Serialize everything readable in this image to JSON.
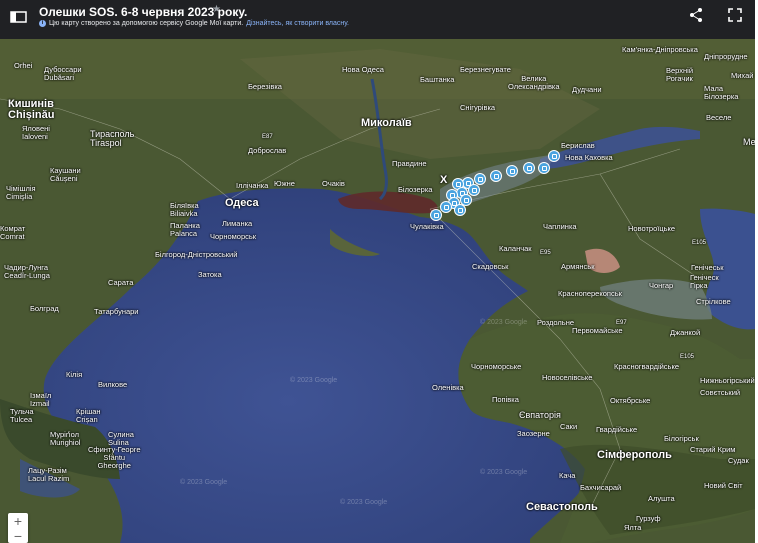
{
  "header": {
    "title": "Олешки SOS. 6-8 червня 2023 року.",
    "subtitle": "Цю карту створено за допомогою сервісу Google Мої карти.",
    "learn_link": "Дізнайтесь, як створити власну.",
    "icons": [
      "menu-icon",
      "star-icon",
      "info-icon",
      "share-icon",
      "fullscreen-icon"
    ]
  },
  "map": {
    "places": [
      {
        "name": "Orhei"
      },
      {
        "name": "Дубоссари\nDubăsari"
      },
      {
        "name": "Кишинів\nChișinău"
      },
      {
        "name": "Яловені\nIaloveni"
      },
      {
        "name": "Тирасполь\nTiraspol"
      },
      {
        "name": "Каушани\nCăușeni"
      },
      {
        "name": "Чімішлія\nCimişlia"
      },
      {
        "name": "Комрат\nComrat"
      },
      {
        "name": "Чадир-Лунга\nCeadîr-Lunga"
      },
      {
        "name": "Болград"
      },
      {
        "name": "Ізмаїл\nIzmail"
      },
      {
        "name": "Тульча\nTulcea"
      },
      {
        "name": "Кілія"
      },
      {
        "name": "Вилкове"
      },
      {
        "name": "Крішан\nCrișan"
      },
      {
        "name": "Муріґіол\nMurighiol"
      },
      {
        "name": "Сулина\nSulina"
      },
      {
        "name": "Сфинту-Георге\nSfântu\nGheorghe"
      },
      {
        "name": "Лацу-Разім\nLacul Razim"
      },
      {
        "name": "Сарата"
      },
      {
        "name": "Татарбунари"
      },
      {
        "name": "Біляївка\nBiliaivka"
      },
      {
        "name": "Паланка\nPalanca"
      },
      {
        "name": "Одеса"
      },
      {
        "name": "Лиманка"
      },
      {
        "name": "Чорноморськ"
      },
      {
        "name": "Білгород-Дністровський"
      },
      {
        "name": "Затока"
      },
      {
        "name": "Ізмаїл"
      },
      {
        "name": "Березівка"
      },
      {
        "name": "Нова Одеса"
      },
      {
        "name": "Баштанка"
      },
      {
        "name": "Березнегувате"
      },
      {
        "name": "Велика\nОлександрівка"
      },
      {
        "name": "Снігурівка"
      },
      {
        "name": "Миколаїв"
      },
      {
        "name": "Доброслав"
      },
      {
        "name": "Правдине"
      },
      {
        "name": "Іллічанка"
      },
      {
        "name": "Южне"
      },
      {
        "name": "Очаків"
      },
      {
        "name": "Білозерка"
      },
      {
        "name": "Х"
      },
      {
        "name": "Берислав"
      },
      {
        "name": "Нова Каховка"
      },
      {
        "name": "Дудчани"
      },
      {
        "name": "Кам'янка-Дніпровська"
      },
      {
        "name": "Дніпрорудне"
      },
      {
        "name": "Верхній\nРогачик"
      },
      {
        "name": "Михай"
      },
      {
        "name": "Мала\nБілозерка"
      },
      {
        "name": "Веселе"
      },
      {
        "name": "Ме"
      },
      {
        "name": "Чаплинка"
      },
      {
        "name": "Новотроїцьке"
      },
      {
        "name": "Чулаківка"
      },
      {
        "name": "Каланчак"
      },
      {
        "name": "Скадовськ"
      },
      {
        "name": "Армянськ"
      },
      {
        "name": "Чонгар"
      },
      {
        "name": "Генічеськ"
      },
      {
        "name": "Геніческ\nГірка"
      },
      {
        "name": "Стрілкове"
      },
      {
        "name": "Красноперекопськ"
      },
      {
        "name": "Роздольне"
      },
      {
        "name": "Первомайське"
      },
      {
        "name": "Джанкой"
      },
      {
        "name": "Чорноморське"
      },
      {
        "name": "Оленівка"
      },
      {
        "name": "Новоселівське"
      },
      {
        "name": "Красногвардійське"
      },
      {
        "name": "Нижньогірський"
      },
      {
        "name": "Совєтський"
      },
      {
        "name": "Октябрське"
      },
      {
        "name": "Попівка"
      },
      {
        "name": "Євпаторія"
      },
      {
        "name": "Саки"
      },
      {
        "name": "Заозерне"
      },
      {
        "name": "Гвардійське"
      },
      {
        "name": "Білогірськ"
      },
      {
        "name": "Старий Крим"
      },
      {
        "name": "Судак"
      },
      {
        "name": "Сімферополь"
      },
      {
        "name": "Бахчисарай"
      },
      {
        "name": "Алушта"
      },
      {
        "name": "Новий Світ"
      },
      {
        "name": "Севастополь"
      },
      {
        "name": "Ялта"
      },
      {
        "name": "Гурзуф"
      },
      {
        "name": "Кача"
      },
      {
        "name": "Роздольне"
      }
    ],
    "road_labels": [
      "E95",
      "E87",
      "E97",
      "E105",
      "E105"
    ],
    "watermark": "© 2023 Google",
    "marker_icon": "map-pin-icon",
    "colors": {
      "water": "#3a4f8c",
      "land": "#4b5a35",
      "marker": "#4aa3df",
      "header": "#202124"
    }
  },
  "zoom": {
    "in": "+",
    "out": "−"
  }
}
